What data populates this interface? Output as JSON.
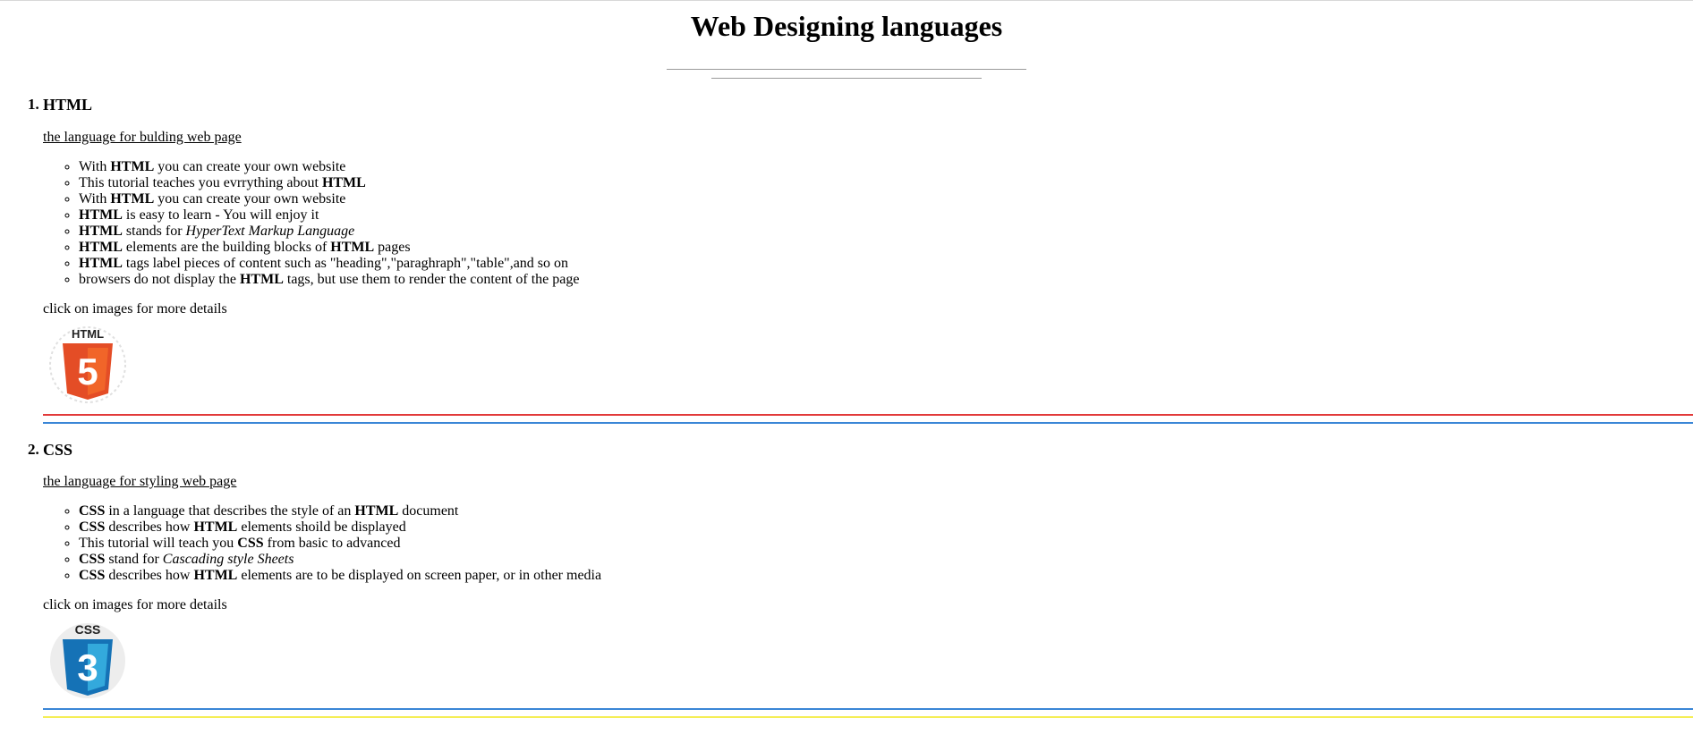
{
  "page": {
    "title": "Web Designing languages"
  },
  "sections": [
    {
      "number": "1.",
      "name": "HTML",
      "subtitle": "the language for bulding web page",
      "points": [
        [
          {
            "t": "With "
          },
          {
            "t": "HTML",
            "b": true
          },
          {
            "t": " you can create your own website"
          }
        ],
        [
          {
            "t": "This tutorial teaches you evrrything about "
          },
          {
            "t": "HTML",
            "b": true
          }
        ],
        [
          {
            "t": "With "
          },
          {
            "t": "HTML",
            "b": true
          },
          {
            "t": " you can create your own website"
          }
        ],
        [
          {
            "t": "HTML",
            "b": true
          },
          {
            "t": " is easy to learn - You will enjoy it"
          }
        ],
        [
          {
            "t": "HTML",
            "b": true
          },
          {
            "t": " stands for "
          },
          {
            "t": "HyperText Markup Language",
            "i": true
          }
        ],
        [
          {
            "t": "HTML",
            "b": true
          },
          {
            "t": " elements are the building blocks of "
          },
          {
            "t": "HTML",
            "b": true
          },
          {
            "t": " pages"
          }
        ],
        [
          {
            "t": "HTML",
            "b": true
          },
          {
            "t": " tags label pieces of content such as \"heading\",\"paraghraph\",\"table\",and so on"
          }
        ],
        [
          {
            "t": "browsers do not display the "
          },
          {
            "t": "HTML",
            "b": true
          },
          {
            "t": " tags, but use them to render the content of the page"
          }
        ]
      ],
      "more": "click on images for more details",
      "logo": {
        "icon": "html5-logo-icon",
        "text": "HTML",
        "digit": "5",
        "color": "#e44d26",
        "color_light": "#f16529"
      }
    },
    {
      "number": "2.",
      "name": "CSS",
      "subtitle": "the language for styling web page",
      "points": [
        [
          {
            "t": "CSS",
            "b": true
          },
          {
            "t": " in a language that describes the style of an "
          },
          {
            "t": "HTML",
            "b": true
          },
          {
            "t": " document"
          }
        ],
        [
          {
            "t": "CSS",
            "b": true
          },
          {
            "t": " describes how "
          },
          {
            "t": "HTML",
            "b": true
          },
          {
            "t": " elements shoild be displayed"
          }
        ],
        [
          {
            "t": "This tutorial will teach you "
          },
          {
            "t": "CSS",
            "b": true
          },
          {
            "t": " from basic to advanced"
          }
        ],
        [
          {
            "t": "CSS",
            "b": true
          },
          {
            "t": " stand for "
          },
          {
            "t": "Cascading style Sheets",
            "i": true
          }
        ],
        [
          {
            "t": "CSS",
            "b": true
          },
          {
            "t": " describes how "
          },
          {
            "t": "HTML",
            "b": true
          },
          {
            "t": " elements are to be displayed on screen paper, or in other media"
          }
        ]
      ],
      "more": "click on images for more details",
      "logo": {
        "icon": "css3-logo-icon",
        "text": "CSS",
        "digit": "3",
        "color": "#1572b6",
        "color_light": "#33a9dc"
      }
    }
  ]
}
